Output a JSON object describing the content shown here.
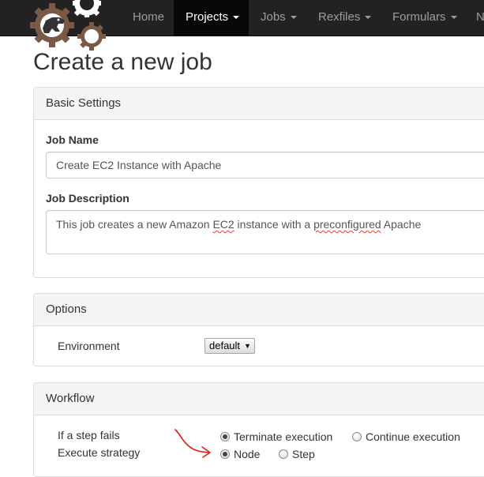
{
  "nav": {
    "items": [
      {
        "label": "Home",
        "dropdown": false
      },
      {
        "label": "Projects",
        "dropdown": true,
        "active": true
      },
      {
        "label": "Jobs",
        "dropdown": true
      },
      {
        "label": "Rexfiles",
        "dropdown": true
      },
      {
        "label": "Formulars",
        "dropdown": true
      },
      {
        "label": "N",
        "dropdown": false
      }
    ]
  },
  "page": {
    "title": "Create a new job"
  },
  "basic_settings": {
    "heading": "Basic Settings",
    "job_name_label": "Job Name",
    "job_name_value": "Create EC2 Instance with Apache",
    "job_description_label": "Job Description",
    "job_description_value": {
      "part1": "This job creates a new Amazon ",
      "part2": "EC2",
      "part3": " instance with a ",
      "part4": "preconfigured",
      "part5": " Apache"
    }
  },
  "options": {
    "heading": "Options",
    "environment_label": "Environment",
    "environment_value": "default",
    "environment_arrow": "▼"
  },
  "workflow": {
    "heading": "Workflow",
    "step_fails_label": "If a step fails",
    "step_fails_options": [
      {
        "label": "Terminate execution",
        "checked": true
      },
      {
        "label": "Continue execution",
        "checked": false
      }
    ],
    "execute_strategy_label": "Execute strategy",
    "execute_strategy_options": [
      {
        "label": "Node",
        "checked": true
      },
      {
        "label": "Step",
        "checked": false
      }
    ]
  },
  "colors": {
    "navbar_bg": "#222222",
    "navbar_active_bg": "#080808",
    "panel_heading_bg": "#f5f5f5",
    "annotation_arrow": "#e0201b",
    "logo_gear_brown": "#7a5a45",
    "logo_gear_white": "#ffffff"
  }
}
